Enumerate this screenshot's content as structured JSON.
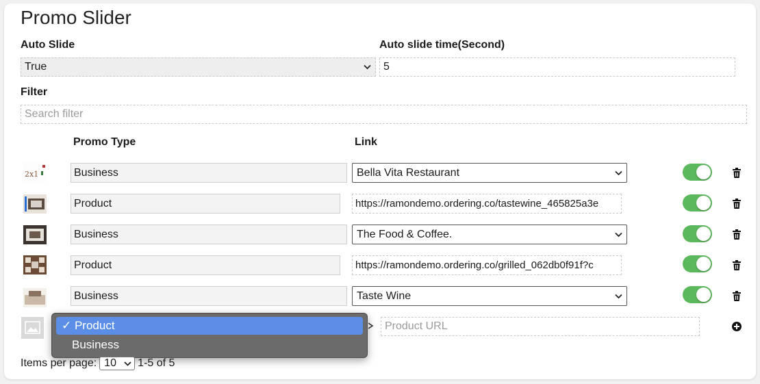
{
  "page": {
    "title": "Promo Slider"
  },
  "settings": {
    "auto_slide_label": "Auto Slide",
    "auto_slide_value": "True",
    "auto_slide_time_label": "Auto slide time(Second)",
    "auto_slide_time_value": "5",
    "filter_label": "Filter",
    "filter_placeholder": "Search filter"
  },
  "table": {
    "headers": {
      "promo_type": "Promo Type",
      "link": "Link"
    },
    "rows": [
      {
        "type": "Business",
        "link": "Bella Vita Restaurant",
        "link_kind": "select",
        "enabled": true
      },
      {
        "type": "Product",
        "link": "https://ramondemo.ordering.co/tastewine_465825a3e",
        "link_kind": "url",
        "enabled": true
      },
      {
        "type": "Business",
        "link": "The Food & Coffee.",
        "link_kind": "select",
        "enabled": true
      },
      {
        "type": "Product",
        "link": "https://ramondemo.ordering.co/grilled_062db0f91f?c",
        "link_kind": "url",
        "enabled": true
      },
      {
        "type": "Business",
        "link": "Taste Wine",
        "link_kind": "select",
        "enabled": true
      }
    ],
    "new_row": {
      "url_placeholder": "Product URL"
    }
  },
  "dropdown": {
    "options": [
      {
        "label": "✓ Product",
        "selected": true
      },
      {
        "label": "Business",
        "selected": false
      }
    ]
  },
  "pagination": {
    "items_per_page_label": "Items per page:",
    "items_per_page_value": "10",
    "range": "1-5 of 5"
  },
  "colors": {
    "toggle_on": "#5cb85c",
    "dropdown_highlight": "#5b8ee6",
    "dropdown_bg": "#6b6b6b"
  },
  "icons": {
    "delete": "trash-icon",
    "add": "plus-circle-icon",
    "select_arrow": "chevron-down-icon"
  }
}
